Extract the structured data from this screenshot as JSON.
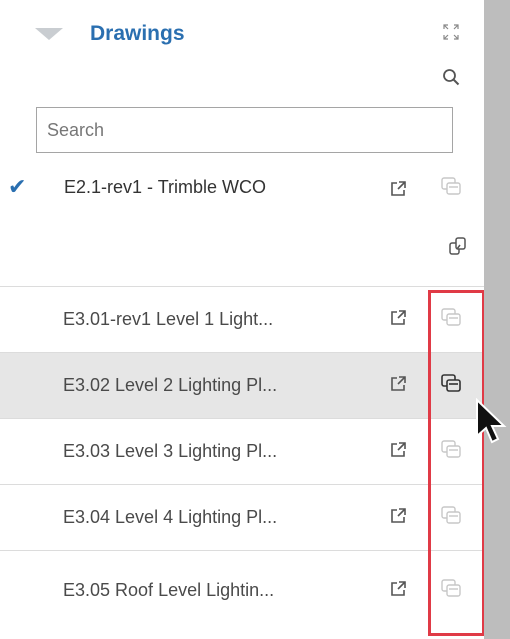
{
  "header": {
    "title": "Drawings",
    "icons": {
      "collapse": "triangle-down-icon",
      "expand": "expand-arrows-icon",
      "search": "search-icon"
    }
  },
  "search": {
    "placeholder": "Search",
    "value": ""
  },
  "selected_parent": {
    "label": "E2.1-rev1 - Trimble WCO",
    "checked": true
  },
  "drawings": [
    {
      "label": "E3.01-rev1 Level 1 Light...",
      "hover": false
    },
    {
      "label": "E3.02 Level 2 Lighting Pl...",
      "hover": true
    },
    {
      "label": "E3.03 Level 3 Lighting Pl...",
      "hover": false
    },
    {
      "label": "E3.04 Level 4 Lighting Pl...",
      "hover": false
    },
    {
      "label": "E3.05 Roof Level Lightin...",
      "hover": false
    }
  ],
  "colors": {
    "accent": "#2a6fb0",
    "highlight": "#e03a46",
    "hover_row": "#e6e6e6",
    "scrollbar": "#bdbdbd"
  }
}
